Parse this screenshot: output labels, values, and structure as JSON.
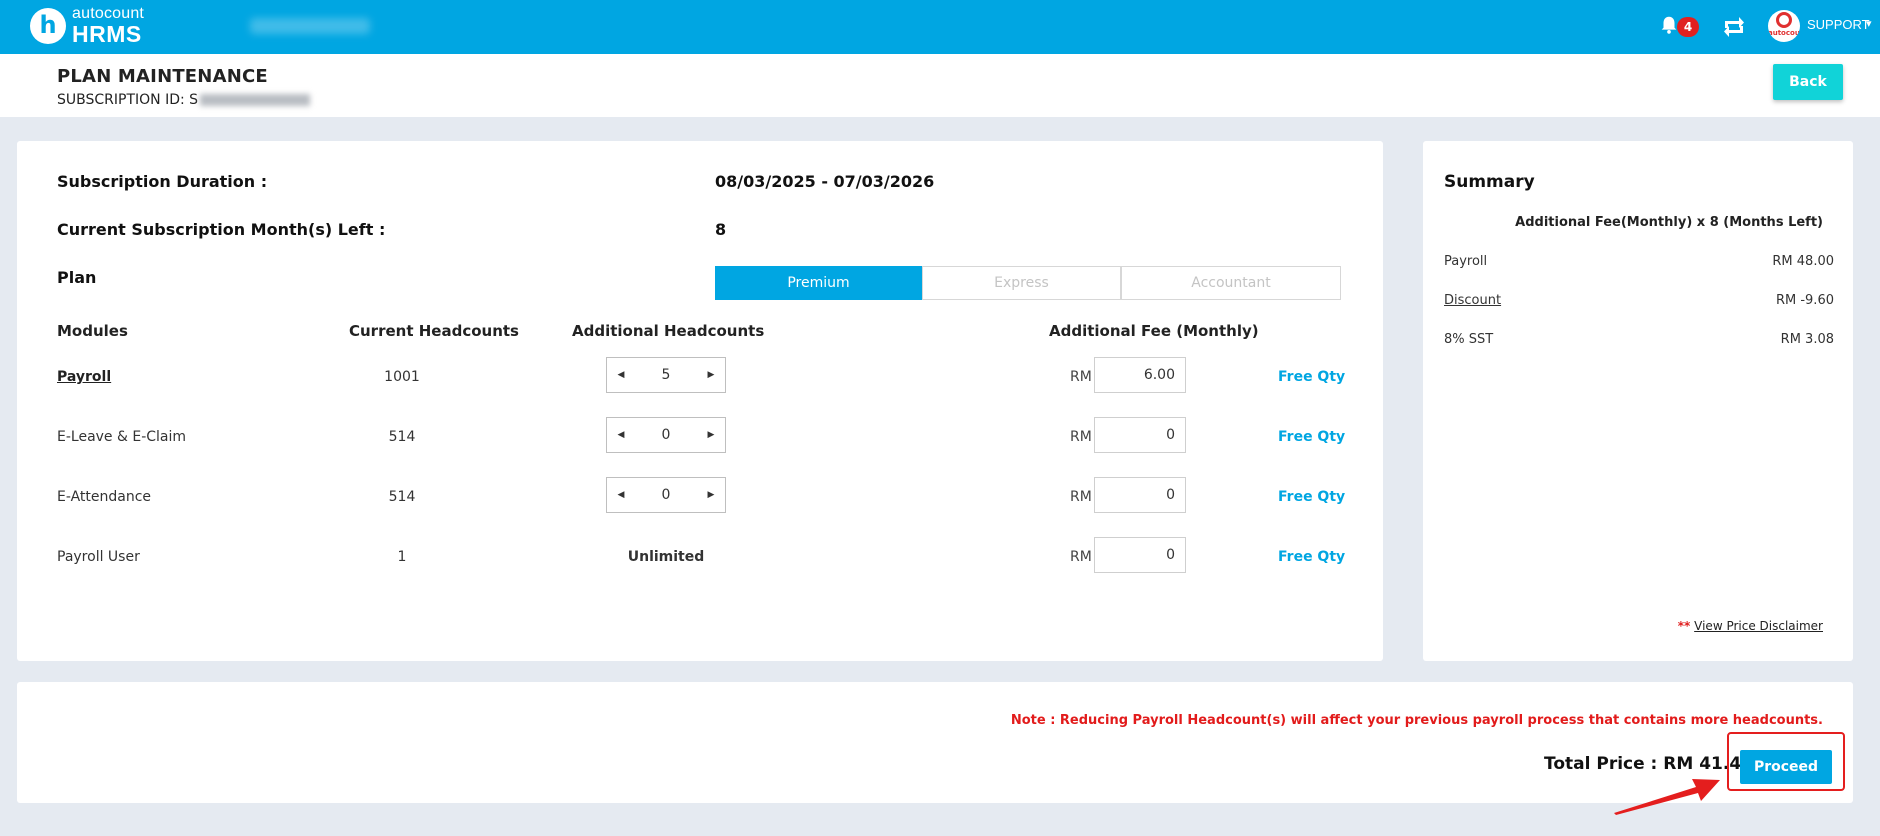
{
  "topbar": {
    "logo_mark": "h",
    "logo_brand": "autocount",
    "logo_product": "HRMS",
    "notification_count": "4",
    "avatar_text": "autocount",
    "user_label": "SUPPORT",
    "brand_color": "#00a6e2"
  },
  "page": {
    "title": "PLAN MAINTENANCE",
    "subscription_label": "SUBSCRIPTION ID: S",
    "back_label": "Back"
  },
  "details": {
    "duration_label": "Subscription Duration :",
    "duration_value": "08/03/2025 - 07/03/2026",
    "months_left_label": "Current Subscription Month(s) Left :",
    "months_left_value": "8",
    "plan_label": "Plan",
    "plans": [
      {
        "label": "Premium",
        "active": true
      },
      {
        "label": "Express",
        "active": false
      },
      {
        "label": "Accountant",
        "active": false
      }
    ]
  },
  "modules_table": {
    "headers": {
      "modules": "Modules",
      "current": "Current Headcounts",
      "additional": "Additional Headcounts",
      "fee": "Additional Fee (Monthly)"
    },
    "currency": "RM",
    "free_qty_label": "Free Qty",
    "rows": [
      {
        "name": "Payroll",
        "current": "1001",
        "additional": "5",
        "fee": "6.00"
      },
      {
        "name": "E-Leave & E-Claim",
        "current": "514",
        "additional": "0",
        "fee": "0"
      },
      {
        "name": "E-Attendance",
        "current": "514",
        "additional": "0",
        "fee": "0"
      },
      {
        "name": "Payroll User",
        "current": "1",
        "additional": "Unlimited",
        "fee": "0"
      }
    ]
  },
  "summary": {
    "title": "Summary",
    "subtitle": "Additional Fee(Monthly) x 8 (Months Left)",
    "rows": [
      {
        "label": "Payroll",
        "value": "RM 48.00"
      },
      {
        "label": "Discount",
        "value": "RM -9.60"
      },
      {
        "label": "8% SST",
        "value": "RM 3.08"
      }
    ],
    "disclaimer_stars": "**",
    "disclaimer_link": "View Price Disclaimer"
  },
  "footer": {
    "note": "Note : Reducing Payroll Headcount(s) will affect your previous payroll process that contains more headcounts.",
    "total_label": "Total Price : RM 41.48",
    "total_stars": "**",
    "proceed_label": "Proceed"
  }
}
